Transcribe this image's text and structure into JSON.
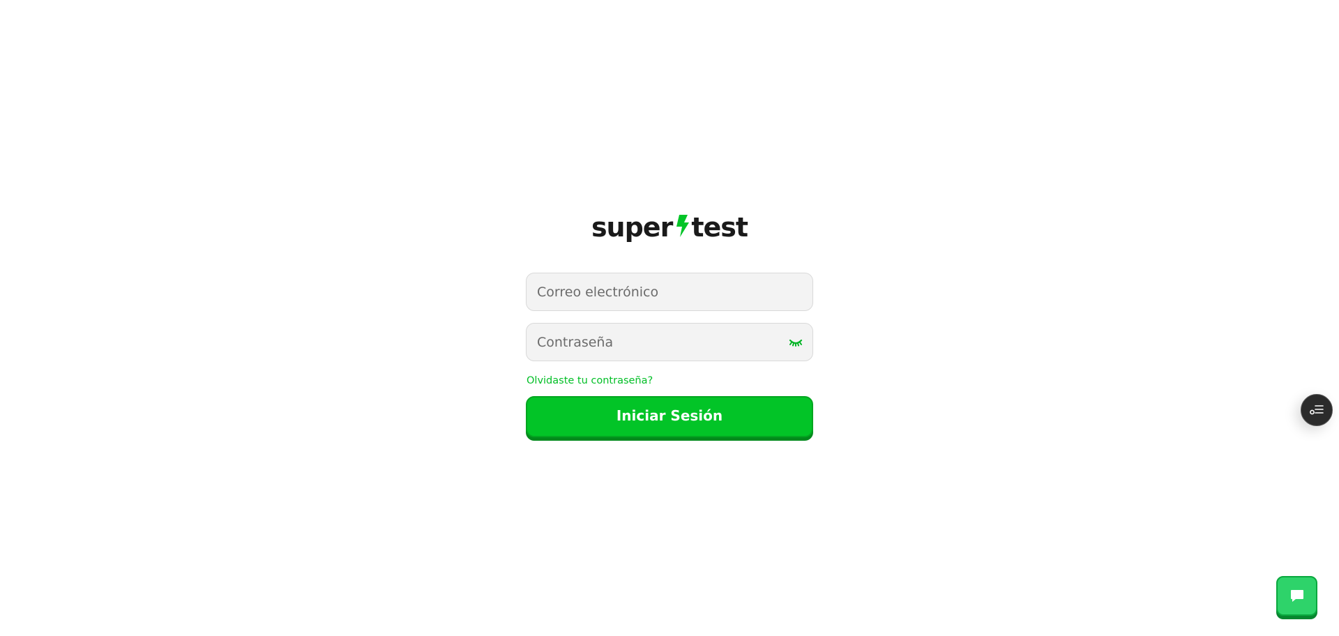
{
  "brand": {
    "name_left": "super",
    "name_right": "test",
    "accent_color": "#02c427",
    "logo_icon": "lightning-bolt-icon"
  },
  "form": {
    "email": {
      "placeholder": "Correo electrónico",
      "value": ""
    },
    "password": {
      "placeholder": "Contraseña",
      "value": "",
      "toggle_icon": "eye-closed-icon"
    },
    "forgot_label": "Olvidaste tu contraseña?",
    "submit_label": "Iniciar Sesión"
  },
  "widgets": {
    "side_icon": "checklist-icon",
    "chat_icon": "chat-bubble-icon"
  }
}
